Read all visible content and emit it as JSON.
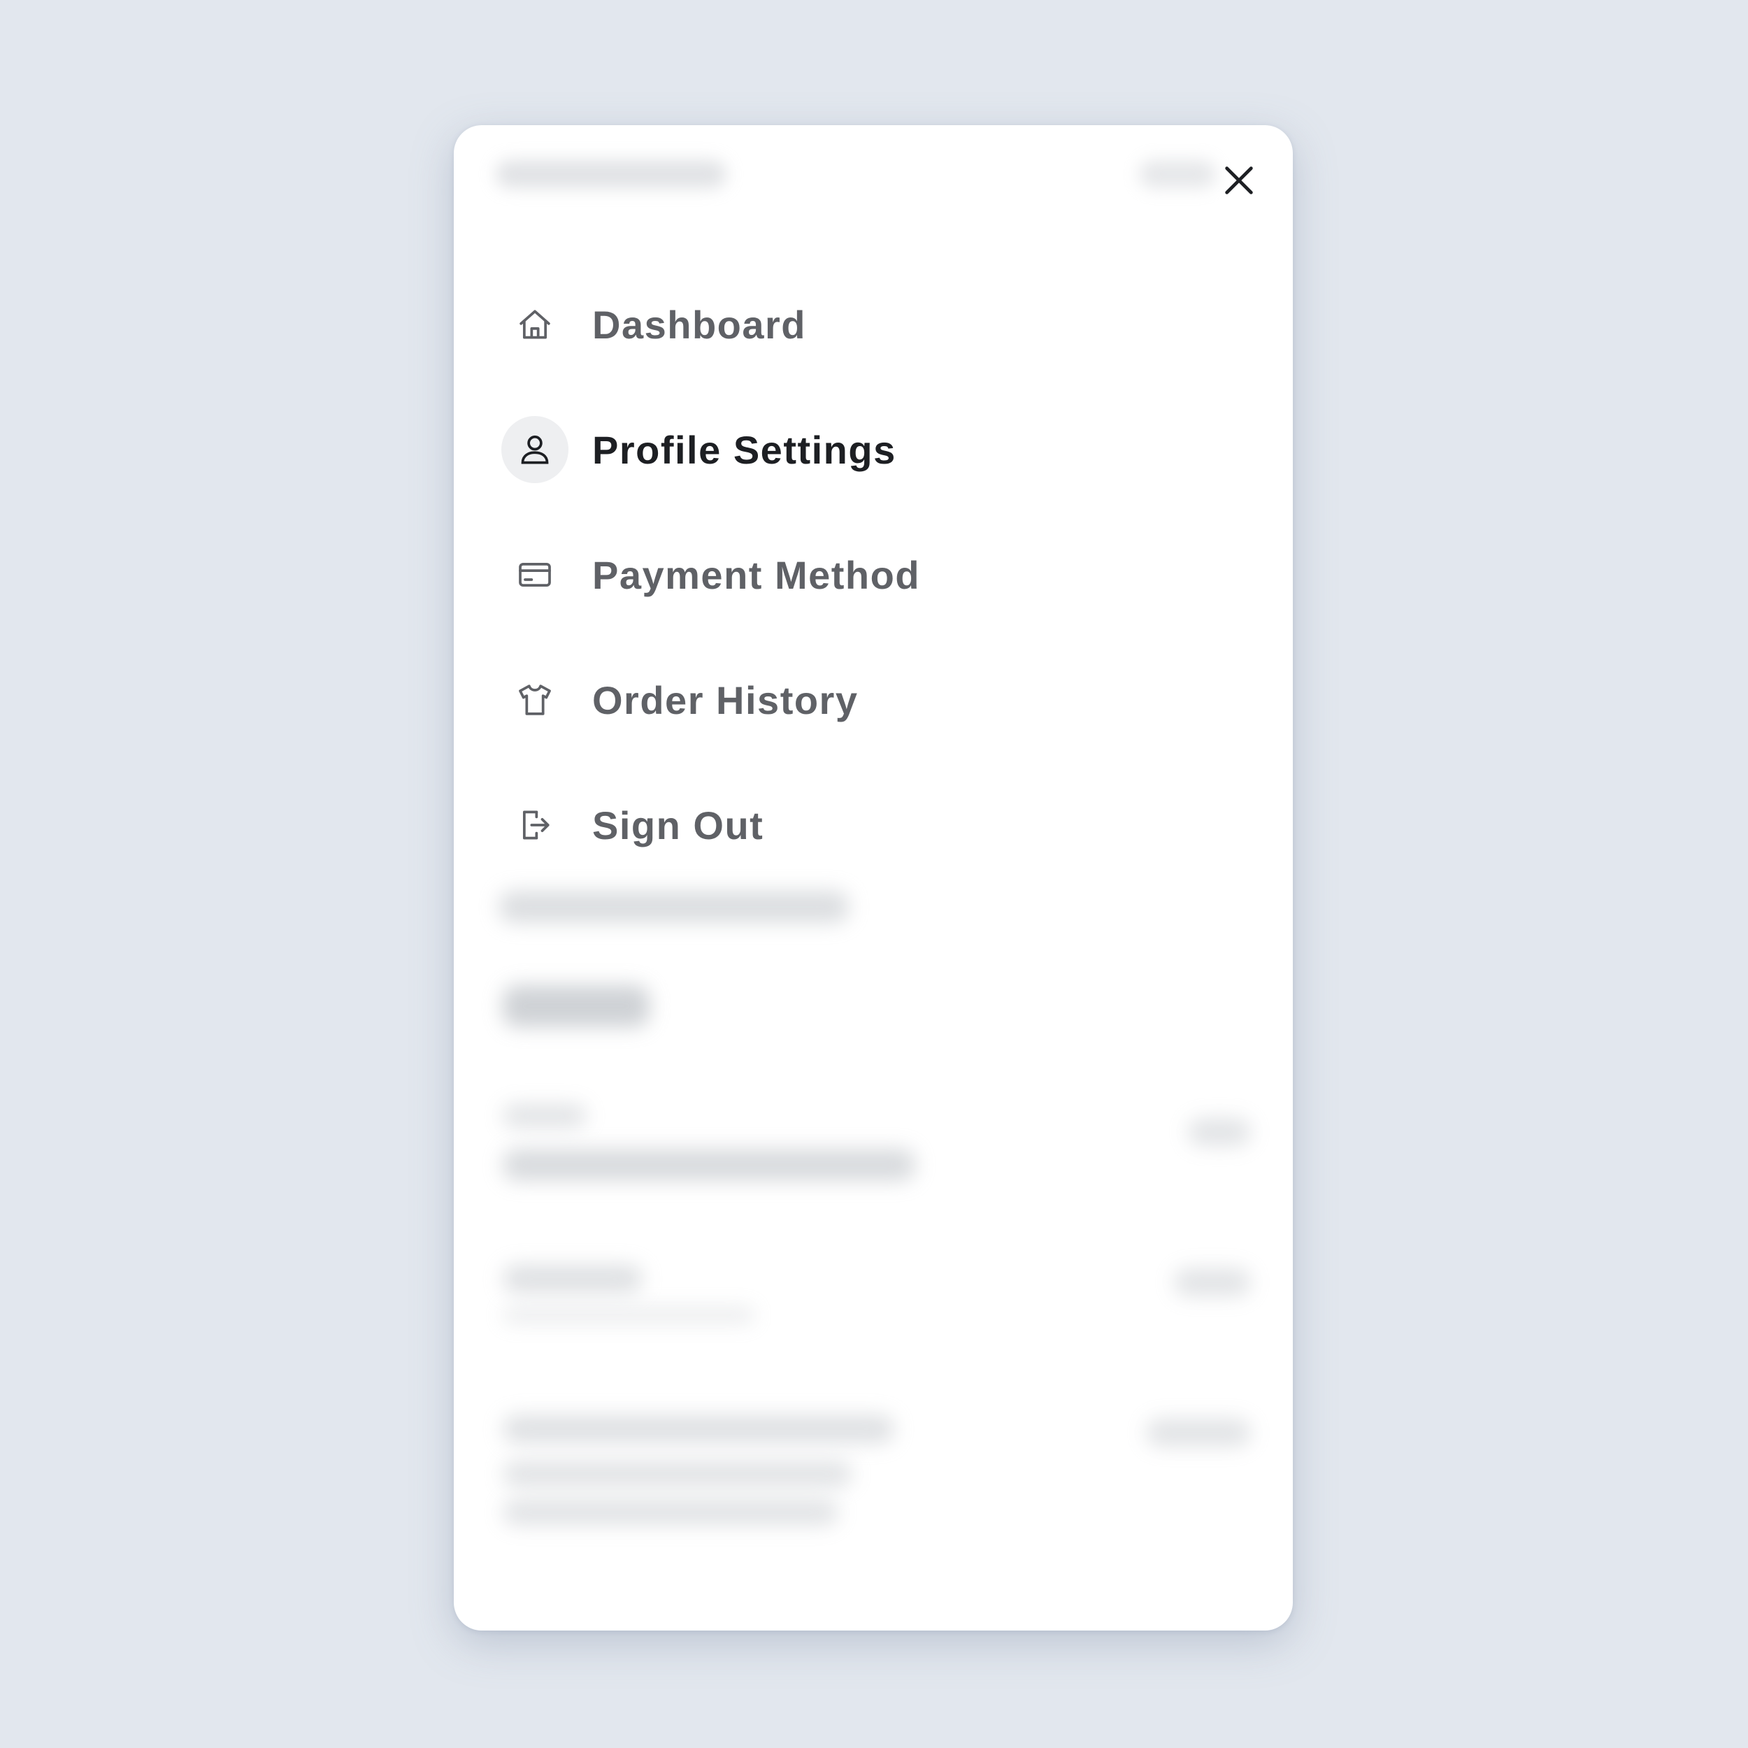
{
  "menu": {
    "close_icon": "close-icon",
    "items": [
      {
        "label": "Dashboard",
        "icon": "home-icon",
        "active": false
      },
      {
        "label": "Profile Settings",
        "icon": "user-icon",
        "active": true
      },
      {
        "label": "Payment Method",
        "icon": "credit-card-icon",
        "active": false
      },
      {
        "label": "Order History",
        "icon": "shirt-icon",
        "active": false
      },
      {
        "label": "Sign Out",
        "icon": "sign-out-icon",
        "active": false
      }
    ]
  },
  "colors": {
    "background": "#e2e7ee",
    "panel": "#ffffff",
    "active_text": "#1d1f23",
    "inactive_text": "#5f6166",
    "active_icon_bg": "#eeeff1"
  }
}
